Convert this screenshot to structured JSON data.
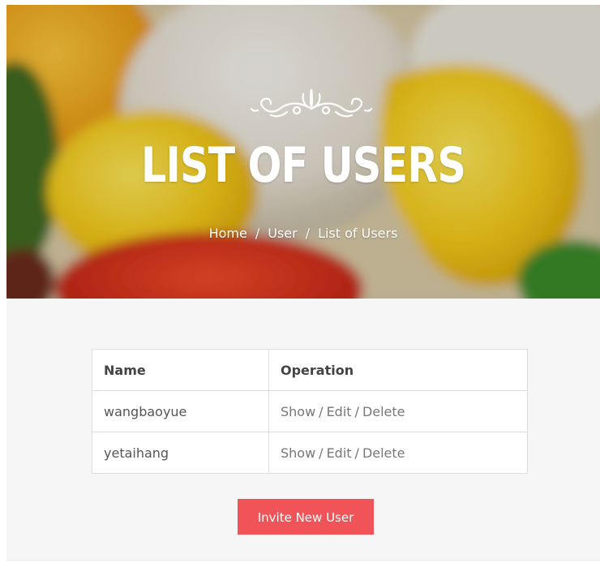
{
  "hero": {
    "title": "LIST OF USERS",
    "breadcrumb": [
      "Home",
      "User",
      "List of Users"
    ],
    "separator": "/"
  },
  "table": {
    "headers": [
      "Name",
      "Operation"
    ],
    "rows": [
      {
        "name": "wangbaoyue",
        "actions": [
          "Show",
          "Edit",
          "Delete"
        ]
      },
      {
        "name": "yetaihang",
        "actions": [
          "Show",
          "Edit",
          "Delete"
        ]
      }
    ]
  },
  "actions": {
    "invite_label": "Invite New User"
  },
  "colors": {
    "accent": "#f05459",
    "content_bg": "#f6f6f6",
    "border": "#dddddd"
  }
}
